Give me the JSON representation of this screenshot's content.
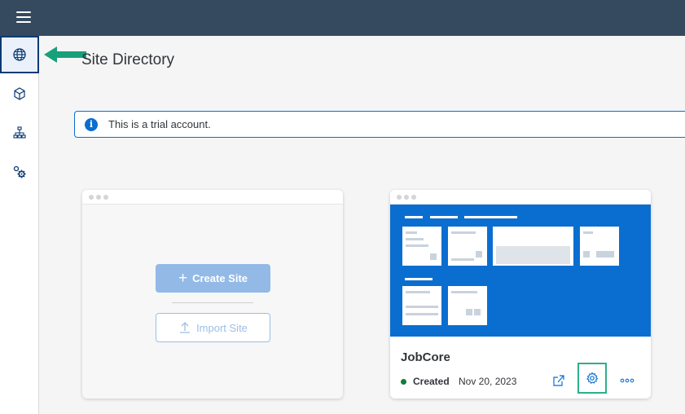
{
  "topbar": {
    "menu_icon": "hamburger-icon",
    "background": "#354a5f"
  },
  "sidebar": {
    "items": [
      {
        "name": "globe",
        "icon": "globe-icon",
        "active": true
      },
      {
        "name": "content",
        "icon": "cube-icon",
        "active": false
      },
      {
        "name": "sitemap",
        "icon": "hierarchy-icon",
        "active": false
      },
      {
        "name": "settings",
        "icon": "gears-icon",
        "active": false
      }
    ]
  },
  "page": {
    "title": "Site Directory"
  },
  "info": {
    "text": "This is a trial account.",
    "icon": "info-icon"
  },
  "new_site_card": {
    "create_label": "Create Site",
    "import_label": "Import Site"
  },
  "site_card": {
    "name": "JobCore",
    "status": "Created",
    "date": "Nov 20, 2023",
    "status_color": "#107e3e",
    "actions": [
      "share-icon",
      "settings-icon",
      "more-icon"
    ]
  },
  "colors": {
    "accent": "#0a6ed1",
    "highlight": "#2eb08a"
  }
}
